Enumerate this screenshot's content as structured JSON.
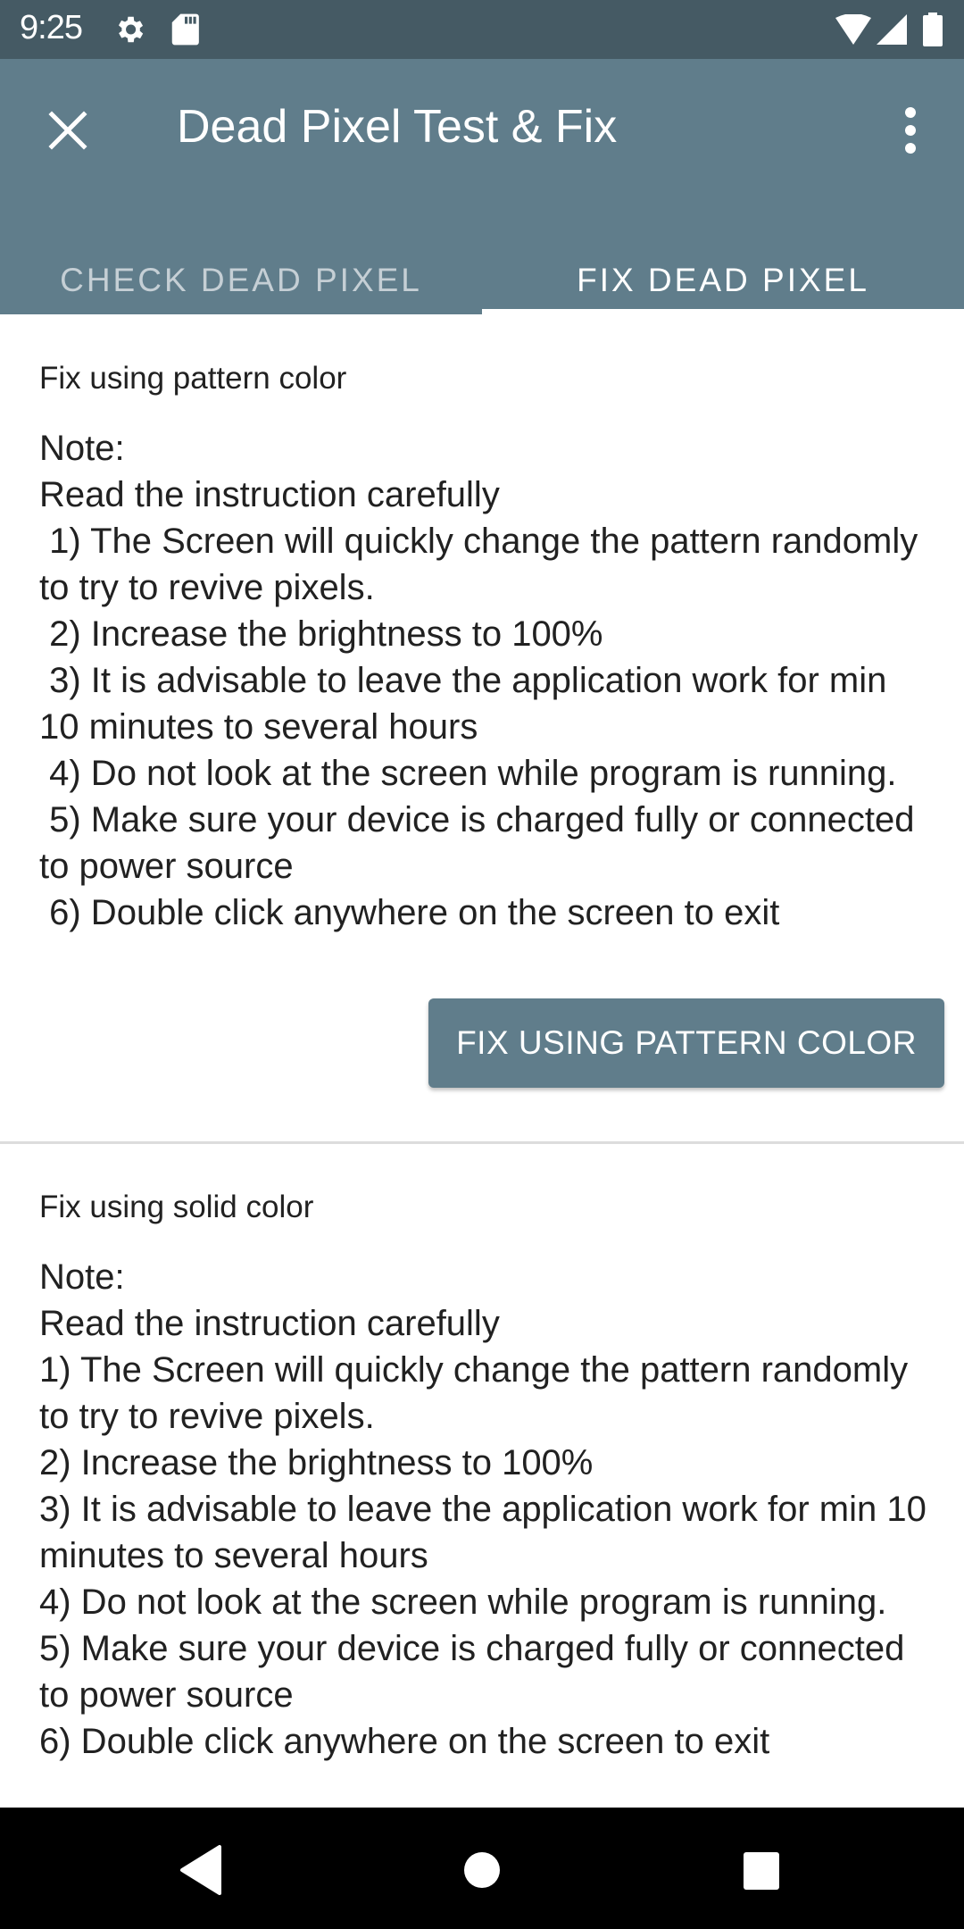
{
  "status_bar": {
    "time": "9:25",
    "left_icons": [
      "settings-icon",
      "sd-card-icon"
    ],
    "right_icons": [
      "wifi-icon",
      "cell-signal-icon",
      "battery-icon"
    ]
  },
  "app_bar": {
    "title": "Dead Pixel Test & Fix",
    "close_icon": "close-icon",
    "menu_icon": "more-vert-icon"
  },
  "tabs": [
    {
      "label": "CHECK DEAD PIXEL",
      "selected": false
    },
    {
      "label": "FIX DEAD PIXEL",
      "selected": true
    }
  ],
  "colors": {
    "status_bar": "#455a64",
    "primary": "#607d8b",
    "tab_inactive": "#c5cfd5",
    "text": "#212121",
    "divider": "#dcdcdc"
  },
  "sections": [
    {
      "label": "Fix using pattern color",
      "note": "Note:\nRead the instruction carefully\n 1) The Screen will quickly change the pattern randomly to try to revive pixels.\n 2) Increase the brightness to 100%\n 3) It is advisable to leave the application work for min 10 minutes to several hours\n 4) Do not look at the screen while program is running.\n 5) Make sure your device is charged fully or connected to power source\n 6) Double click anywhere on the screen to exit",
      "button_label": "FIX USING PATTERN COLOR"
    },
    {
      "label": "Fix using solid color",
      "note": "Note:\nRead the instruction carefully\n1) The Screen will quickly change the pattern randomly to try to revive pixels.\n2) Increase the brightness to 100%\n3) It is advisable to leave the application work for min 10 minutes to several hours\n4) Do not look at the screen while program is running.\n5) Make sure your device is charged fully or connected to power source\n6) Double click anywhere on the screen to exit"
    }
  ],
  "nav_bar": {
    "buttons": [
      "back-icon",
      "home-icon",
      "recents-icon"
    ]
  }
}
